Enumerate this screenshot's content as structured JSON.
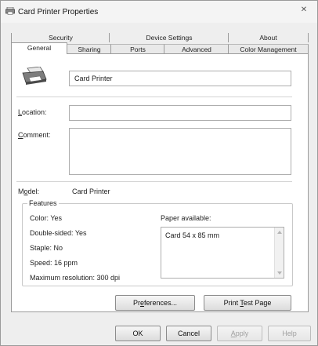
{
  "window": {
    "title": "Card Printer Properties",
    "close_glyph": "✕"
  },
  "tabs_row1": [
    {
      "label": "Security"
    },
    {
      "label": "Device Settings"
    },
    {
      "label": "About"
    }
  ],
  "tabs_row2": [
    {
      "label": "General",
      "selected": true
    },
    {
      "label": "Sharing"
    },
    {
      "label": "Ports"
    },
    {
      "label": "Advanced"
    },
    {
      "label": "Color Management"
    }
  ],
  "general": {
    "printer_name": "Card Printer",
    "location_label_pre": "",
    "location_label_ul": "L",
    "location_label_post": "ocation:",
    "location_value": "",
    "comment_label_ul": "C",
    "comment_label_post": "omment:",
    "comment_value": "",
    "model_label_pre": "M",
    "model_label_ul": "o",
    "model_label_post": "del:",
    "model_value": "Card Printer"
  },
  "features": {
    "title": "Features",
    "color": "Color: Yes",
    "double_sided": "Double-sided: Yes",
    "staple": "Staple: No",
    "speed": "Speed: 16 ppm",
    "max_resolution": "Maximum resolution: 300 dpi",
    "paper_available_label": "Paper available:",
    "paper_items": [
      "Card 54 x 85 mm"
    ]
  },
  "buttons": {
    "preferences_pre": "Pr",
    "preferences_ul": "e",
    "preferences_post": "ferences...",
    "print_test_pre": "Print ",
    "print_test_ul": "T",
    "print_test_post": "est Page",
    "ok": "OK",
    "cancel": "Cancel",
    "apply_ul": "A",
    "apply_post": "pply",
    "help": "Help"
  },
  "colors": {
    "dialog_bg": "#eeeeee",
    "panel_bg": "#ffffff",
    "border": "#9b9b9b"
  }
}
